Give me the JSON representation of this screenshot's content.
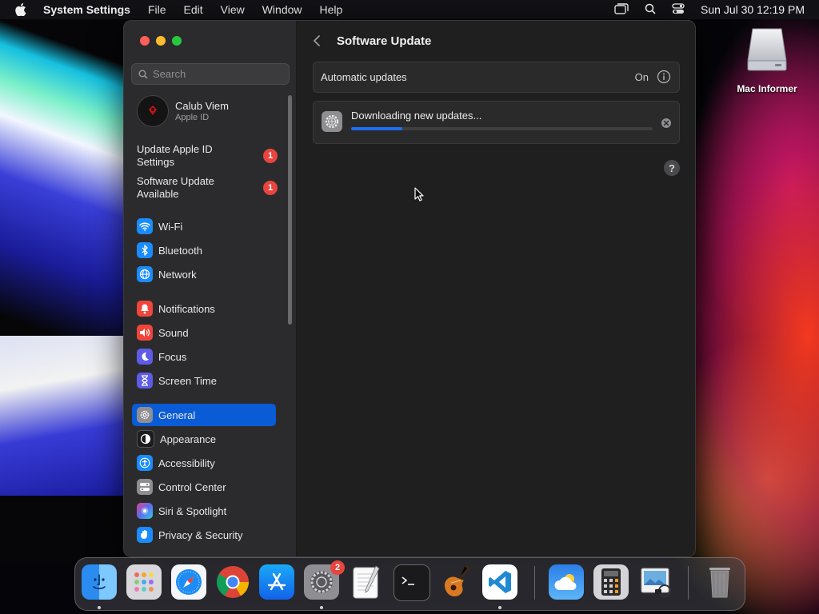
{
  "menubar": {
    "app_name": "System Settings",
    "menus": [
      "File",
      "Edit",
      "View",
      "Window",
      "Help"
    ],
    "clock": "Sun Jul 30  12:19 PM"
  },
  "desktop": {
    "drive_label": "Mac Informer"
  },
  "sidebar": {
    "search_placeholder": "Search",
    "account": {
      "name": "Calub Viem",
      "subtitle": "Apple ID"
    },
    "notices": [
      {
        "label": "Update Apple ID Settings",
        "badge": "1"
      },
      {
        "label": "Software Update Available",
        "badge": "1"
      }
    ],
    "items": [
      {
        "label": "Wi-Fi",
        "icon": "wifi-icon",
        "color": "#1a8cff"
      },
      {
        "label": "Bluetooth",
        "icon": "bluetooth-icon",
        "color": "#1a8cff"
      },
      {
        "label": "Network",
        "icon": "globe-icon",
        "color": "#1a8cff"
      },
      {
        "label": "Notifications",
        "icon": "bell-icon",
        "color": "#f0453a"
      },
      {
        "label": "Sound",
        "icon": "speaker-icon",
        "color": "#f0453a"
      },
      {
        "label": "Focus",
        "icon": "moon-icon",
        "color": "#5e5ce6"
      },
      {
        "label": "Screen Time",
        "icon": "hourglass-icon",
        "color": "#5e5ce6"
      },
      {
        "label": "General",
        "icon": "gear-icon",
        "color": "#8e8e93"
      },
      {
        "label": "Appearance",
        "icon": "appearance-icon",
        "color": "#1c1c1e"
      },
      {
        "label": "Accessibility",
        "icon": "accessibility-icon",
        "color": "#1a8cff"
      },
      {
        "label": "Control Center",
        "icon": "toggles-icon",
        "color": "#8e8e93"
      },
      {
        "label": "Siri & Spotlight",
        "icon": "siri-icon",
        "color": "#b04fe0"
      },
      {
        "label": "Privacy & Security",
        "icon": "hand-icon",
        "color": "#1a8cff"
      }
    ],
    "active_item": "General"
  },
  "main": {
    "title": "Software Update",
    "automatic_updates": {
      "label": "Automatic updates",
      "value": "On"
    },
    "download": {
      "label": "Downloading new updates...",
      "progress": 0.17
    },
    "help_label": "?"
  },
  "dock": {
    "apps": [
      "Finder",
      "Launchpad",
      "Safari",
      "Chrome",
      "App Store",
      "System Settings",
      "TextEdit",
      "Terminal",
      "GarageBand",
      "Visual Studio Code",
      "Weather",
      "Calculator",
      "Preview",
      "Trash"
    ],
    "settings_badge": "2"
  },
  "colors": {
    "accent": "#0a5bd6",
    "progress": "#1d6ff2",
    "badge": "#e6463f"
  }
}
